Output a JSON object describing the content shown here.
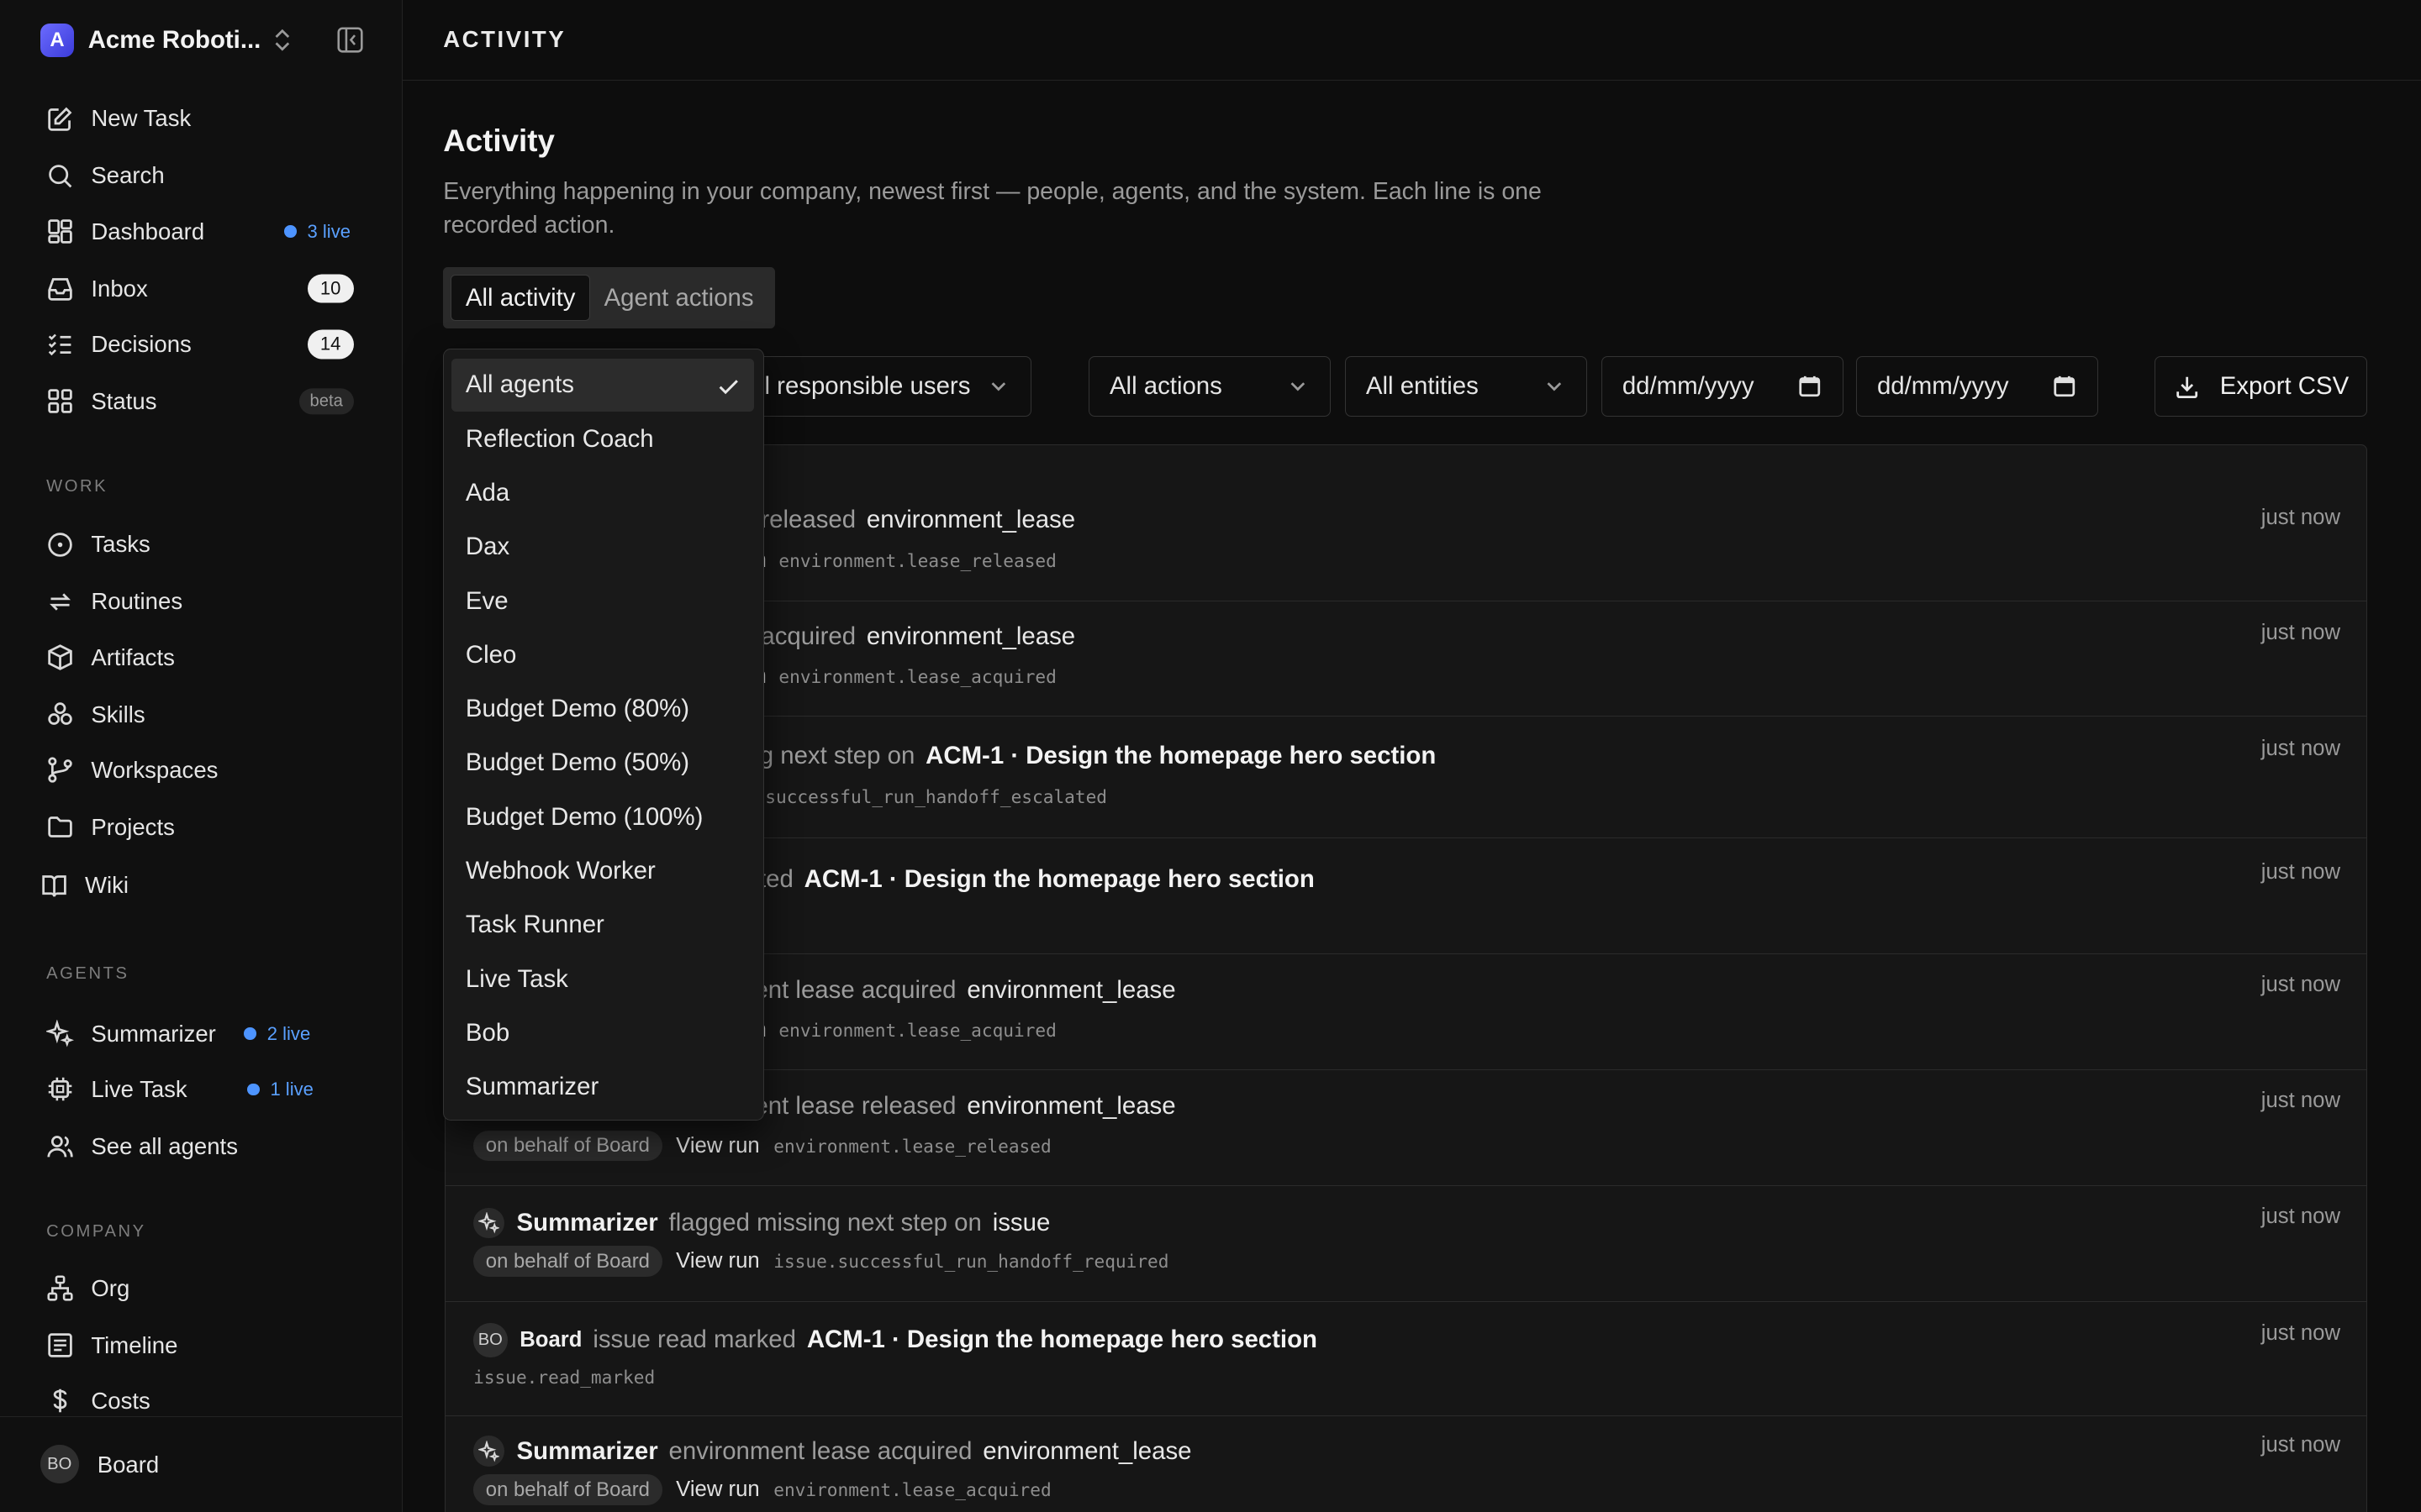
{
  "brand": {
    "logo_letter": "A",
    "name": "Acme Roboti..."
  },
  "nav": {
    "new_task": "New Task",
    "search": "Search",
    "dashboard": "Dashboard",
    "dashboard_live": "3 live",
    "inbox": "Inbox",
    "inbox_count": "10",
    "decisions": "Decisions",
    "decisions_count": "14",
    "status": "Status",
    "status_badge": "beta"
  },
  "work": {
    "title": "WORK",
    "tasks": "Tasks",
    "routines": "Routines",
    "artifacts": "Artifacts",
    "skills": "Skills",
    "workspaces": "Workspaces",
    "projects": "Projects",
    "wiki": "Wiki"
  },
  "agents_nav": {
    "title": "AGENTS",
    "summarizer": "Summarizer",
    "summarizer_live": "2 live",
    "live_task": "Live Task",
    "live_task_live": "1 live",
    "see_all": "See all agents"
  },
  "company": {
    "title": "COMPANY",
    "org": "Org",
    "timeline": "Timeline",
    "costs": "Costs"
  },
  "user": {
    "initials": "BO",
    "name": "Board"
  },
  "topbar": {
    "title": "ACTIVITY"
  },
  "page": {
    "title": "Activity",
    "description": "Everything happening in your company, newest first — people, agents, and the system. Each line is one recorded action."
  },
  "tabs": {
    "all": "All activity",
    "agent": "Agent actions"
  },
  "filters": {
    "responsible": "All responsible users",
    "responsible_visible": "ll responsible users",
    "actions": "All actions",
    "entities": "All entities",
    "date_placeholder": "dd/mm/yyyy",
    "export": "Export CSV"
  },
  "agent_dropdown": {
    "selected": "All agents",
    "options": [
      "All agents",
      "Reflection Coach",
      "Ada",
      "Dax",
      "Eve",
      "Cleo",
      "Budget Demo (80%)",
      "Budget Demo (50%)",
      "Budget Demo (100%)",
      "Webhook Worker",
      "Task Runner",
      "Live Task",
      "Bob",
      "Summarizer"
    ]
  },
  "activity": [
    {
      "verb_visible": "se released",
      "target": "environment_lease",
      "code": "environment.lease_released",
      "time": "just now",
      "frag": "n"
    },
    {
      "verb_visible": "se acquired",
      "target": "environment_lease",
      "code": "environment.lease_acquired",
      "time": "just now",
      "frag": "n"
    },
    {
      "verb_visible": "sing next step on",
      "target": "ACM-1 · Design the homepage hero section",
      "code": "successful_run_handoff_escalated",
      "time": "just now"
    },
    {
      "verb_visible": "ted",
      "target": "ACM-1 · Design the homepage hero section",
      "time": "just now"
    },
    {
      "verb_visible": "ent lease acquired",
      "target": "environment_lease",
      "code": "environment.lease_acquired",
      "time": "just now",
      "frag": "n"
    },
    {
      "verb_visible": "ent lease released",
      "target": "environment_lease",
      "behalf": "on behalf of Board",
      "view_run": "View run",
      "code": "environment.lease_released",
      "time": "just now"
    },
    {
      "actor": "Summarizer",
      "verb": "flagged missing next step on",
      "target": "issue",
      "behalf": "on behalf of Board",
      "view_run": "View run",
      "code": "issue.successful_run_handoff_required",
      "time": "just now"
    },
    {
      "actor_initials": "BO",
      "actor": "Board",
      "verb": "issue read marked",
      "target": "ACM-1 · Design the homepage hero section",
      "code": "issue.read_marked",
      "time": "just now"
    },
    {
      "actor": "Summarizer",
      "verb": "environment lease acquired",
      "target": "environment_lease",
      "behalf": "on behalf of Board",
      "view_run": "View run",
      "code": "environment.lease_acquired",
      "time": "just now"
    }
  ],
  "colors": {
    "background": "#0d0d0d",
    "sidebar": "#101010",
    "live_accent": "#4d94ff",
    "brand": "#4f4fe8"
  }
}
